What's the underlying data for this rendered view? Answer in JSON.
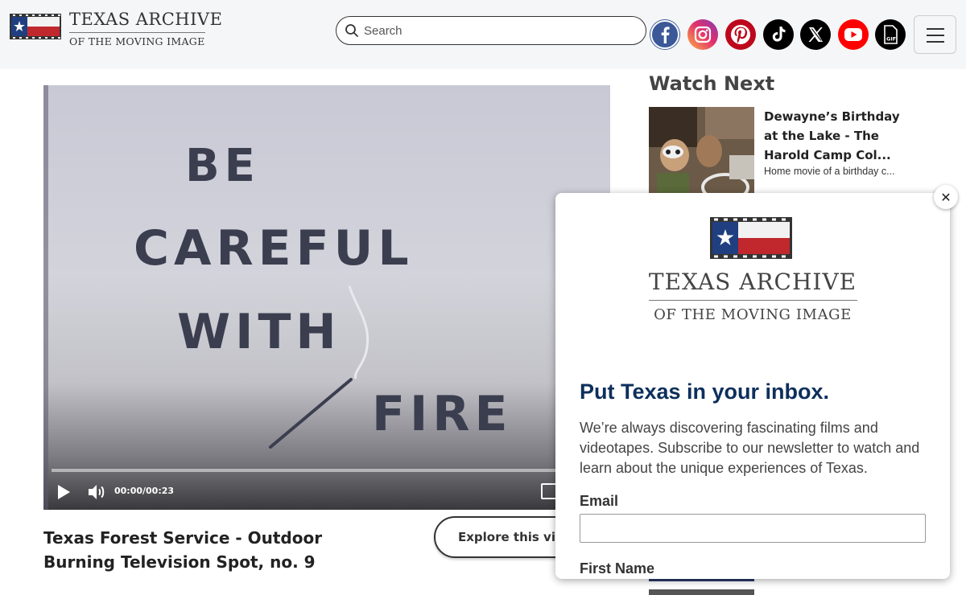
{
  "header": {
    "logo_line1": "TEXAS ARCHIVE",
    "logo_line2": "OF THE MOVING IMAGE",
    "search_placeholder": "Search",
    "social_icons": [
      "facebook-icon",
      "instagram-icon",
      "pinterest-icon",
      "tiktok-icon",
      "x-icon",
      "youtube-icon",
      "gif-icon"
    ],
    "colors": {
      "facebook": "#3b5998",
      "instagram": "#d6249f",
      "pinterest": "#bd081c",
      "tiktok": "#000000",
      "x": "#000000",
      "youtube": "#ff0000",
      "gif": "#000000"
    }
  },
  "video": {
    "frame_text": [
      "BE",
      "CAREFUL",
      "WITH",
      "FIRE"
    ],
    "time": "00:00/00:23",
    "progress": 0
  },
  "main": {
    "title": "Texas Forest Service - Outdoor Burning Television Spot, no. 9",
    "explore_label": "Explore this vid"
  },
  "watch_next": {
    "heading": "Watch Next",
    "items": [
      {
        "title": "Dewayne’s Birthday at the Lake - The Harold Camp Col...",
        "desc": "Home movie of a birthday c..."
      }
    ]
  },
  "popup": {
    "logo_line1": "TEXAS ARCHIVE",
    "logo_line2": "OF THE MOVING IMAGE",
    "heading": "Put Texas in your inbox.",
    "text": "We’re always discovering fascinating films and videotapes. Subscribe to our newsletter to watch and learn about the unique experiences of Texas.",
    "email_label": "Email",
    "email_value": "",
    "first_name_label": "First Name",
    "close_label": "✕",
    "heading_color": "#0d2f5c"
  }
}
